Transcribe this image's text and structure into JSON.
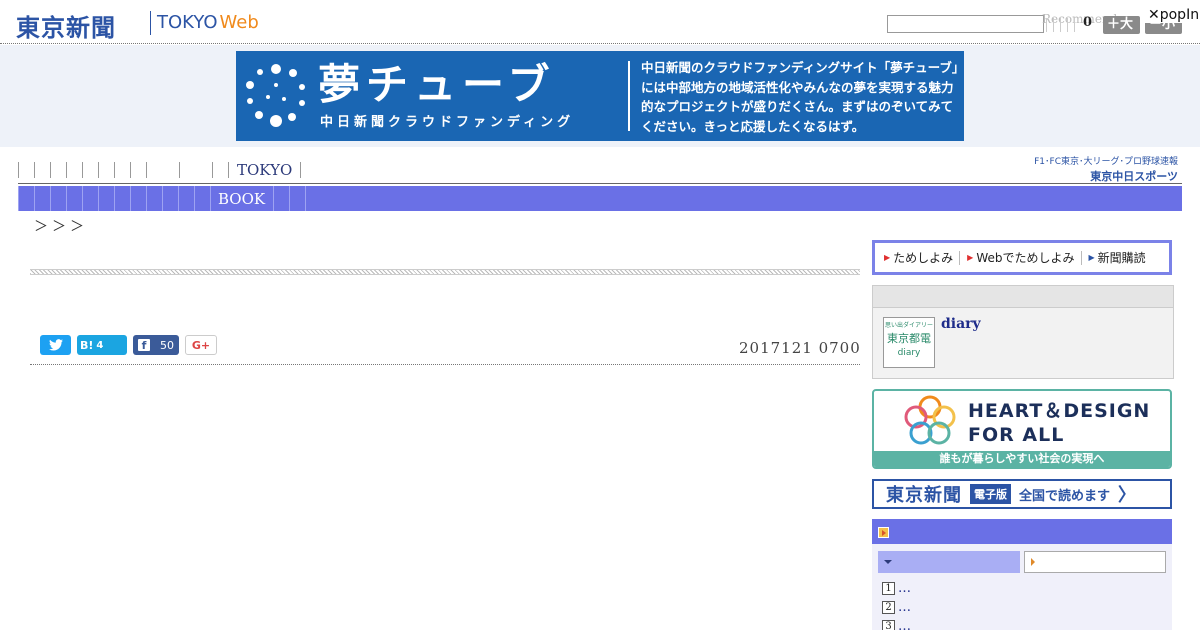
{
  "header": {
    "logo": "東京新聞",
    "logo_sub": "TOKYO",
    "logo_web": "Web",
    "recommend_label": "Recommend",
    "counter": "0",
    "font_large": "＋大",
    "font_small": "－小",
    "popin_label": "✕popIn"
  },
  "ad": {
    "title": "夢チューブ",
    "subtitle": "中日新聞クラウドファンディング",
    "text": "中日新聞のクラウドファンディングサイト「夢チューブ」には中部地方の地域活性化やみんなの夢を実現する魅力的なプロジェクトが盛りだくさん。まずはのぞいてみてください。きっと応援したくなるはず。",
    "color": "#1a66b3"
  },
  "nav": {
    "primary_label": "TOKYO",
    "secondary_label": "BOOK",
    "promo_line1": "F1･FC東京･大リーグ･プロ野球速報",
    "promo_line2": "東京中日スポーツ",
    "accent_color": "#6a70e6"
  },
  "breadcrumb": "＞＞＞",
  "article": {
    "date": "2017121 0700",
    "share": {
      "twitter_icon": "twitter-bird-icon",
      "hatena_label": "B!",
      "hatena_count": "4",
      "facebook_label": "f",
      "facebook_count": "50",
      "gplus_label": "G+"
    }
  },
  "sidebar": {
    "tabs": [
      "ためしよみ",
      "Webでためしよみ",
      "新聞購読"
    ],
    "diary": {
      "thumb_line1": "思い出ダイアリー",
      "thumb_line2": "東京都電",
      "thumb_line3": "diary",
      "link": "diary"
    },
    "heart": {
      "title_line1": "HEART＆DESIGN",
      "title_line2": "FOR ALL",
      "footer": "誰もが暮らしやすい社会の実現へ"
    },
    "digital": {
      "logo": "東京新聞",
      "tag": "電子版",
      "text": "全国で読めます",
      "chevron": "〉"
    },
    "ranking": [
      {
        "num": "1",
        "text": "…"
      },
      {
        "num": "2",
        "text": "…"
      },
      {
        "num": "3",
        "text": "…"
      }
    ]
  }
}
